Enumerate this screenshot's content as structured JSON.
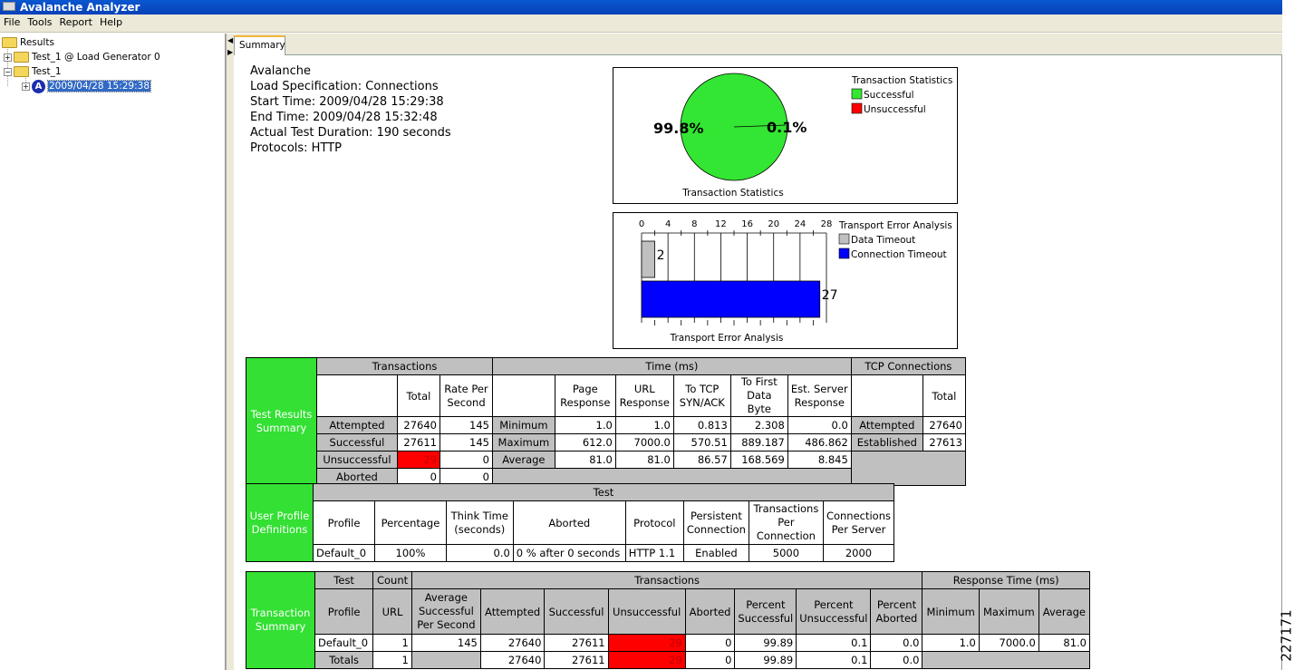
{
  "app": {
    "title": "Avalanche Analyzer",
    "menu": [
      "File",
      "Tools",
      "Report",
      "Help"
    ]
  },
  "tree": {
    "root": "Results",
    "items": [
      "Test_1 @ Load Generator 0",
      "Test_1"
    ],
    "selected_icon": "A",
    "selected": "2009/04/28 15:29:38"
  },
  "tabs": [
    "Summary"
  ],
  "summary": [
    "Avalanche",
    "Load Specification: Connections",
    "Start Time: 2009/04/28 15:29:38",
    "End Time: 2009/04/28 15:32:48",
    "Actual Test Duration: 190 seconds",
    "Protocols: HTTP"
  ],
  "colors": {
    "successful": "#33e633",
    "unsuccessful": "#ff0000",
    "data_timeout": "#c0c0c0",
    "connection_timeout": "#0000ff",
    "summary_green": "#33e033",
    "header_gray": "#c0c0c0"
  },
  "chart_data": [
    {
      "type": "pie",
      "title": "Transaction Statistics",
      "legend_title": "Transaction Statistics",
      "labels": [
        "Successful",
        "Unsuccessful"
      ],
      "values": [
        99.9,
        0.1
      ],
      "data_labels": [
        "99.8%",
        "0.1%"
      ],
      "legend": "top-right"
    },
    {
      "type": "bar",
      "title": "Transport Error Analysis",
      "legend_title": "Transport Error Analysis",
      "orientation": "horizontal",
      "categories": [
        "Data Timeout",
        "Connection Timeout"
      ],
      "values": [
        2,
        27
      ],
      "xticks": [
        "0",
        "4",
        "8",
        "12",
        "16",
        "20",
        "24",
        "28"
      ],
      "xlim": [
        0,
        28
      ],
      "grid": true,
      "legend": "top-right"
    }
  ],
  "results": {
    "side": "Test Results Summary",
    "g1": "Transactions",
    "g2": "Time (ms)",
    "g3": "TCP Connections",
    "tx_cols": [
      "Total",
      "Rate Per Second"
    ],
    "time_cols": [
      "Page Response",
      "URL Response",
      "To TCP SYN/ACK",
      "To First Data Byte",
      "Est. Server Response"
    ],
    "tcp_cols": [
      "Total"
    ],
    "tx_rows": [
      [
        "Attempted",
        "27640",
        "145"
      ],
      [
        "Successful",
        "27611",
        "145"
      ],
      [
        "Unsuccessful",
        "29",
        "0"
      ],
      [
        "Aborted",
        "0",
        "0"
      ]
    ],
    "time_rows": [
      [
        "Minimum",
        "1.0",
        "1.0",
        "0.813",
        "2.308",
        "0.0"
      ],
      [
        "Maximum",
        "612.0",
        "7000.0",
        "570.51",
        "889.187",
        "486.862"
      ],
      [
        "Average",
        "81.0",
        "81.0",
        "86.57",
        "168.569",
        "8.845"
      ]
    ],
    "tcp_rows": [
      [
        "Attempted",
        "27640"
      ],
      [
        "Established",
        "27613"
      ]
    ]
  },
  "profile": {
    "side": "User Profile Definitions",
    "group": "Test",
    "cols": [
      "Profile",
      "Percentage",
      "Think Time (seconds)",
      "Aborted",
      "Protocol",
      "Persistent Connection",
      "Transactions Per Connection",
      "Connections Per Server"
    ],
    "row": [
      "Default_0",
      "100%",
      "0.0",
      "0 % after 0 seconds",
      "HTTP 1.1",
      "Enabled",
      "5000",
      "2000"
    ]
  },
  "txsum": {
    "side": "Transaction Summary",
    "g1": "Test",
    "g2": "Count",
    "g3": "Transactions",
    "g4": "Response Time (ms)",
    "cols": [
      "Profile",
      "URL",
      "Average Successful Per Second",
      "Attempted",
      "Successful",
      "Unsuccessful",
      "Aborted",
      "Percent Successful",
      "Percent Unsuccessful",
      "Percent Aborted",
      "Minimum",
      "Maximum",
      "Average"
    ],
    "row1": [
      "Default_0",
      "1",
      "145",
      "27640",
      "27611",
      "29",
      "0",
      "99.89",
      "0.1",
      "0.0",
      "1.0",
      "7000.0",
      "81.0"
    ],
    "row2": [
      "Totals",
      "1",
      "27640",
      "27611",
      "29",
      "0",
      "99.89",
      "0.1",
      "0.0"
    ]
  },
  "figure_id": "227171"
}
